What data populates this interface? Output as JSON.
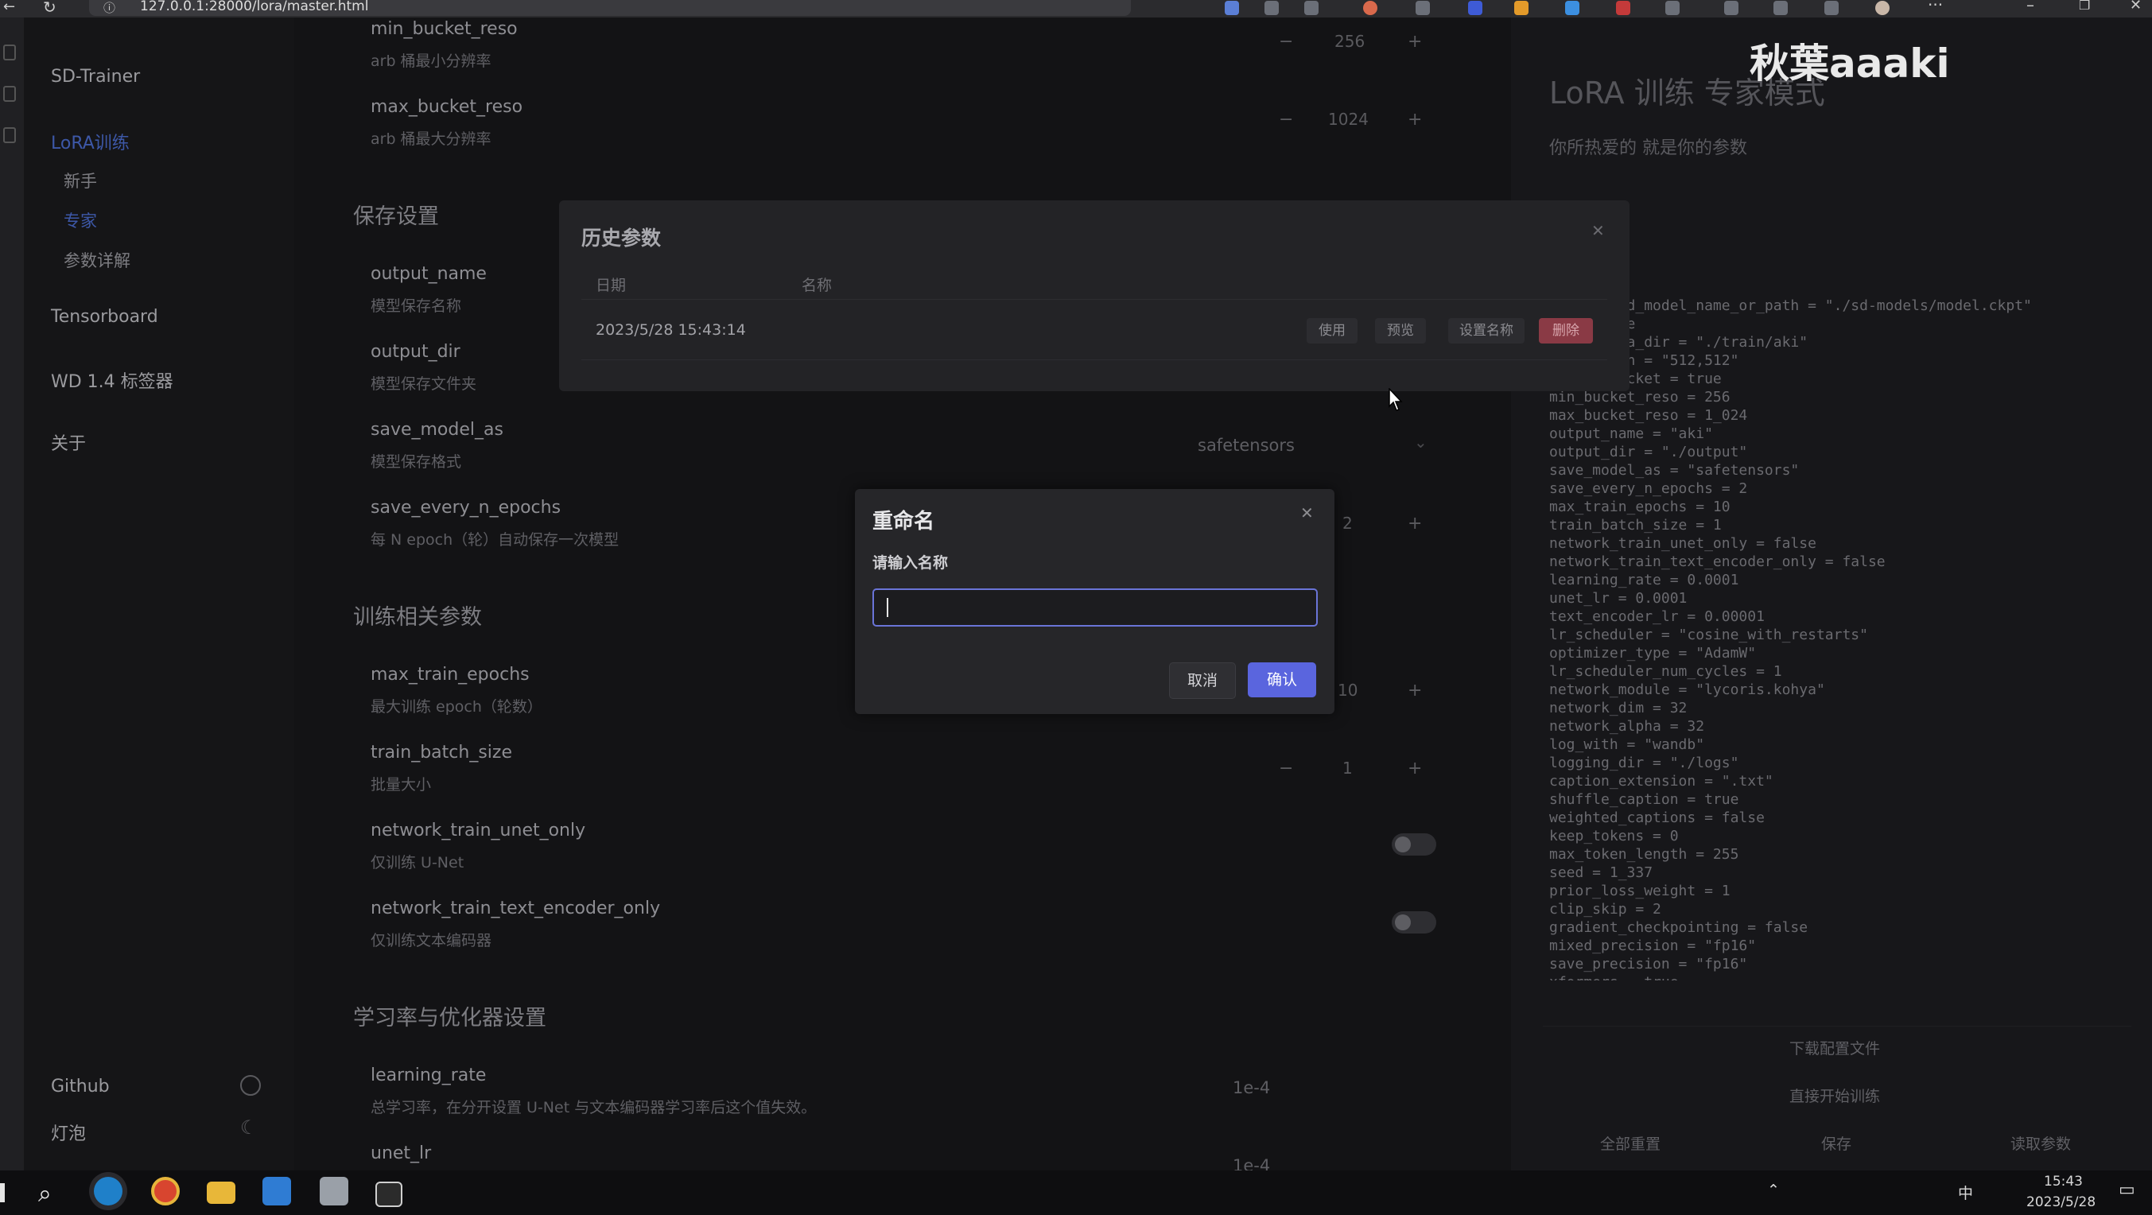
{
  "browser": {
    "url": "127.0.0.1:28000/lora/master.html"
  },
  "sidebar": {
    "app_title": "SD-Trainer",
    "items": [
      {
        "label": "LoRA训练"
      },
      {
        "label": "新手"
      },
      {
        "label": "专家"
      },
      {
        "label": "参数详解"
      },
      {
        "label": "Tensorboard"
      },
      {
        "label": "WD 1.4 标签器"
      },
      {
        "label": "关于"
      }
    ],
    "github_label": "Github",
    "theme_label": "灯泡"
  },
  "main": {
    "params_top": [
      {
        "name": "min_bucket_reso",
        "desc": "arb 桶最小分辨率",
        "value": "256"
      },
      {
        "name": "max_bucket_reso",
        "desc": "arb 桶最大分辨率",
        "value": "1024"
      }
    ],
    "section_save": "保存设置",
    "save_params": [
      {
        "name": "output_name",
        "desc": "模型保存名称"
      },
      {
        "name": "output_dir",
        "desc": "模型保存文件夹"
      },
      {
        "name": "save_model_as",
        "desc": "模型保存格式",
        "value": "safetensors"
      },
      {
        "name": "save_every_n_epochs",
        "desc": "每 N epoch（轮）自动保存一次模型",
        "value": "2"
      }
    ],
    "section_train": "训练相关参数",
    "train_params": [
      {
        "name": "max_train_epochs",
        "desc": "最大训练 epoch（轮数）",
        "value": "10"
      },
      {
        "name": "train_batch_size",
        "desc": "批量大小",
        "value": "1"
      },
      {
        "name": "network_train_unet_only",
        "desc": "仅训练 U-Net"
      },
      {
        "name": "network_train_text_encoder_only",
        "desc": "仅训练文本编码器"
      }
    ],
    "section_lr": "学习率与优化器设置",
    "lr_params": [
      {
        "name": "learning_rate",
        "desc": "总学习率，在分开设置 U-Net 与文本编码器学习率后这个值失效。",
        "value": "1e-4"
      },
      {
        "name": "unet_lr",
        "value": "1e-4"
      }
    ]
  },
  "right_panel": {
    "title": "LoRA 训练 专家模式",
    "subtitle": "你所热爱的 就是你的参数",
    "config_lines": [
      "pretrained_model_name_or_path = \"./sd-models/model.ckpt\"",
      "v2 = false",
      "train_data_dir = \"./train/aki\"",
      "resolution = \"512,512\"",
      "enable_bucket = true",
      "min_bucket_reso = 256",
      "max_bucket_reso = 1_024",
      "output_name = \"aki\"",
      "output_dir = \"./output\"",
      "save_model_as = \"safetensors\"",
      "save_every_n_epochs = 2",
      "max_train_epochs = 10",
      "train_batch_size = 1",
      "network_train_unet_only = false",
      "network_train_text_encoder_only = false",
      "learning_rate = 0.0001",
      "unet_lr = 0.0001",
      "text_encoder_lr = 0.00001",
      "lr_scheduler = \"cosine_with_restarts\"",
      "optimizer_type = \"AdamW\"",
      "lr_scheduler_num_cycles = 1",
      "network_module = \"lycoris.kohya\"",
      "network_dim = 32",
      "network_alpha = 32",
      "log_with = \"wandb\"",
      "logging_dir = \"./logs\"",
      "caption_extension = \".txt\"",
      "shuffle_caption = true",
      "weighted_captions = false",
      "keep_tokens = 0",
      "max_token_length = 255",
      "seed = 1_337",
      "prior_loss_weight = 1",
      "clip_skip = 2",
      "gradient_checkpointing = false",
      "mixed_precision = \"fp16\"",
      "save_precision = \"fp16\"",
      "xformers = true"
    ],
    "download_label": "下载配置文件",
    "start_label": "直接开始训练",
    "reset_label": "全部重置",
    "save_label": "保存",
    "load_label": "读取参数"
  },
  "history_dialog": {
    "title": "历史参数",
    "col_date": "日期",
    "col_name": "名称",
    "rows": [
      {
        "date": "2023/5/28 15:43:14"
      }
    ],
    "btn_use": "使用",
    "btn_preview": "预览",
    "btn_rename": "设置名称",
    "btn_delete": "删除"
  },
  "rename_dialog": {
    "title": "重命名",
    "label": "请输入名称",
    "input_value": "",
    "cancel_label": "取消",
    "confirm_label": "确认"
  },
  "watermark": {
    "text": "秋葉aaaki",
    "logo": "bilibili"
  },
  "taskbar": {
    "time": "15:43",
    "date": "2023/5/28",
    "ime": "中"
  },
  "colors": {
    "accent": "#5a65de",
    "delete": "#8a3a45",
    "sidebar_active": "#3d58a8"
  }
}
